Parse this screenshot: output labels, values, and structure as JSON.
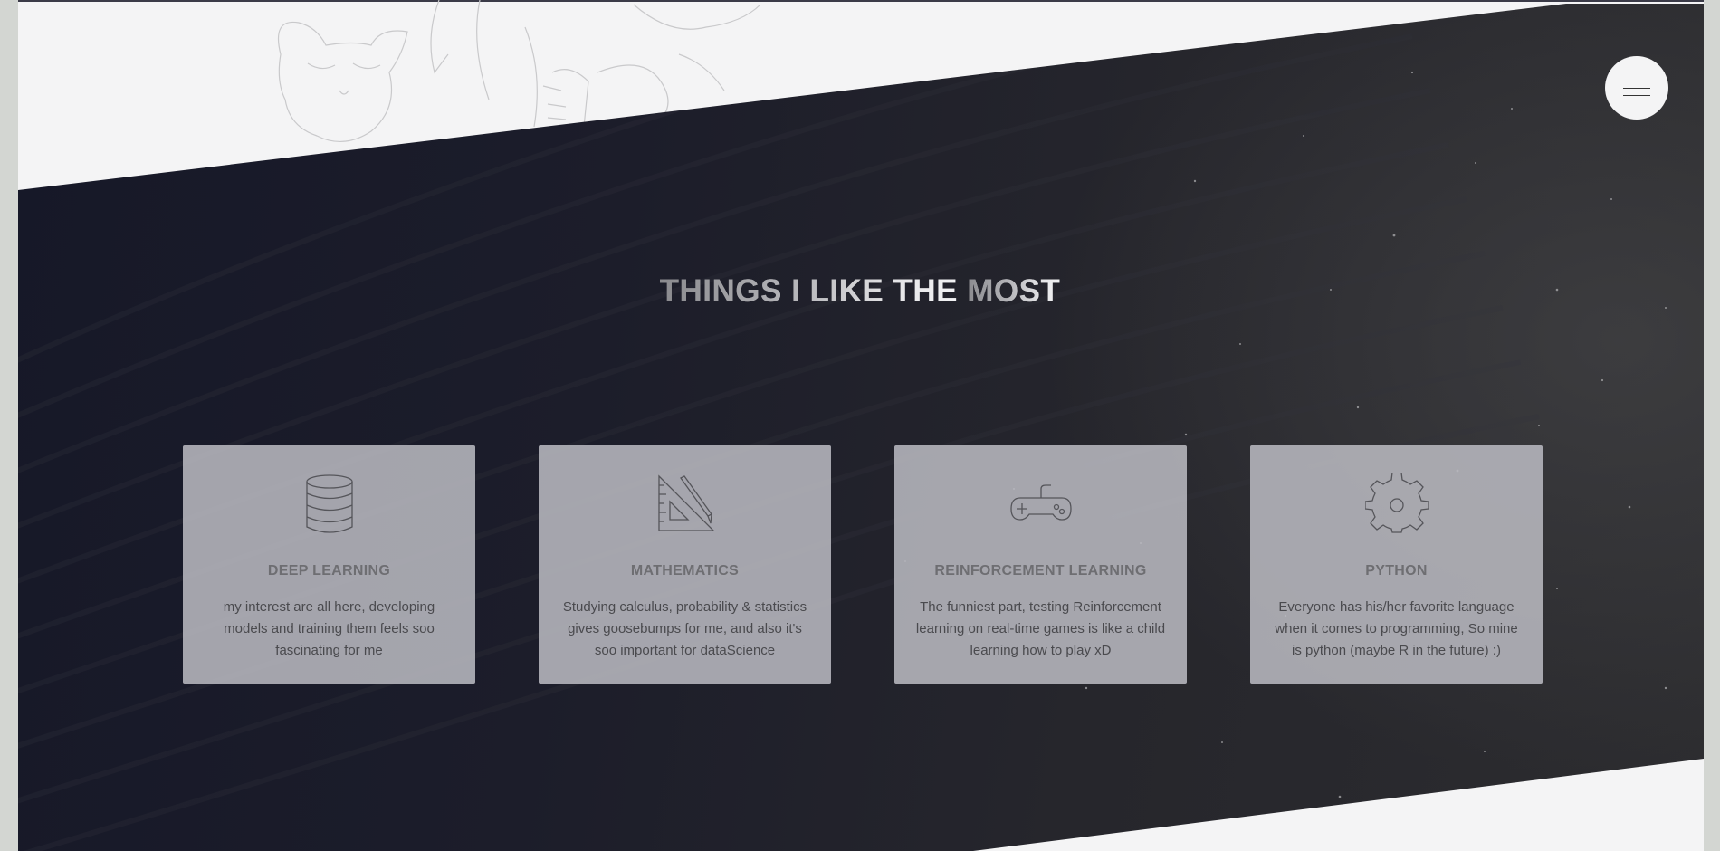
{
  "section": {
    "title_part1": "THINGS I LIKE THE",
    "title_part2": "MOST"
  },
  "menu": {
    "icon": "hamburger-icon"
  },
  "cards": [
    {
      "icon": "database-icon",
      "title": "DEEP LEARNING",
      "text": "my interest are all here, developing models and training them feels soo fascinating for me"
    },
    {
      "icon": "ruler-triangle-icon",
      "title": "MATHEMATICS",
      "text": "Studying calculus, probability & statistics gives goosebumps for me, and also it's soo important for dataScience"
    },
    {
      "icon": "gamepad-icon",
      "title": "REINFORCEMENT LEARNING",
      "text": "The funniest part, testing Reinforcement learning on real-time games is like a child learning how to play xD"
    },
    {
      "icon": "gear-icon",
      "title": "PYTHON",
      "text": "Everyone has his/her favorite language when it comes to programming, So mine is python (maybe R in the future) :)"
    }
  ],
  "colors": {
    "band_dark": "#1c1d2a",
    "card_bg": "#bcbcc2",
    "light_bg": "#f4f4f5"
  }
}
